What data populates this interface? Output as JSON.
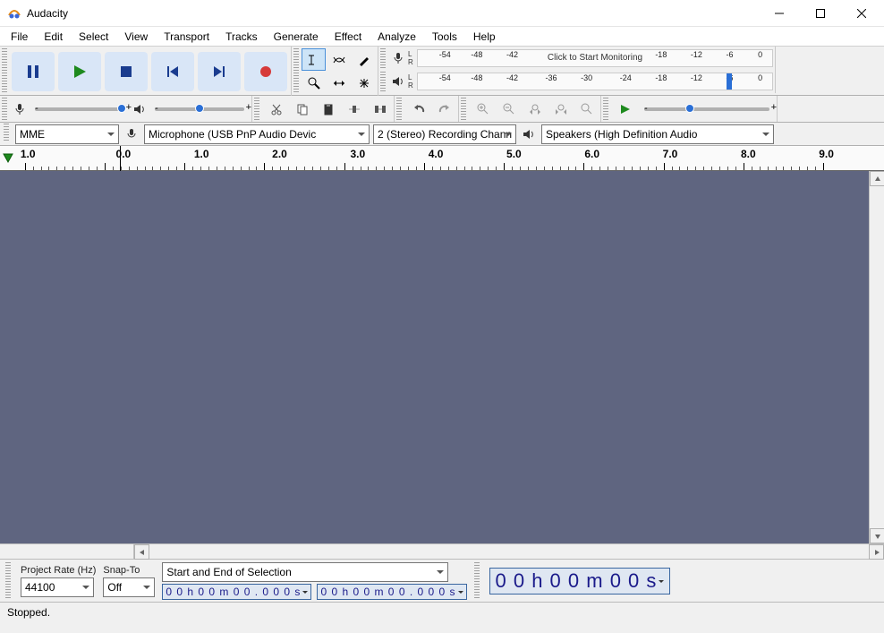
{
  "titlebar": {
    "title": "Audacity"
  },
  "menubar": {
    "items": [
      "File",
      "Edit",
      "Select",
      "View",
      "Transport",
      "Tracks",
      "Generate",
      "Effect",
      "Analyze",
      "Tools",
      "Help"
    ]
  },
  "meters": {
    "recording": {
      "ticks": [
        "-54",
        "-48",
        "-42",
        "",
        "-18",
        "-12",
        "-6",
        "0"
      ],
      "click_text": "Click to Start Monitoring"
    },
    "playback": {
      "ticks": [
        "-54",
        "-48",
        "-42",
        "-36",
        "-30",
        "-24",
        "-18",
        "-12",
        "-6",
        "0"
      ]
    }
  },
  "device_bar": {
    "host": "MME",
    "rec_device": "Microphone (USB PnP Audio Devic",
    "channels": "2 (Stereo) Recording Chann",
    "play_device": "Speakers (High Definition Audio"
  },
  "timeline": {
    "labels": [
      "1.0",
      "0.0",
      "1.0",
      "2.0",
      "3.0",
      "4.0",
      "5.0",
      "6.0",
      "7.0",
      "8.0",
      "9.0"
    ]
  },
  "selection": {
    "project_rate_label": "Project Rate (Hz)",
    "project_rate": "44100",
    "snap_label": "Snap-To",
    "snap": "Off",
    "type_label": "Start and End of Selection",
    "start": "0 0 h 0 0 m 0 0 . 0 0 0 s",
    "end": "0 0 h 0 0 m 0 0 . 0 0 0 s",
    "audio_time": "0 0 h 0 0 m 0 0 s"
  },
  "status": {
    "text": "Stopped."
  }
}
